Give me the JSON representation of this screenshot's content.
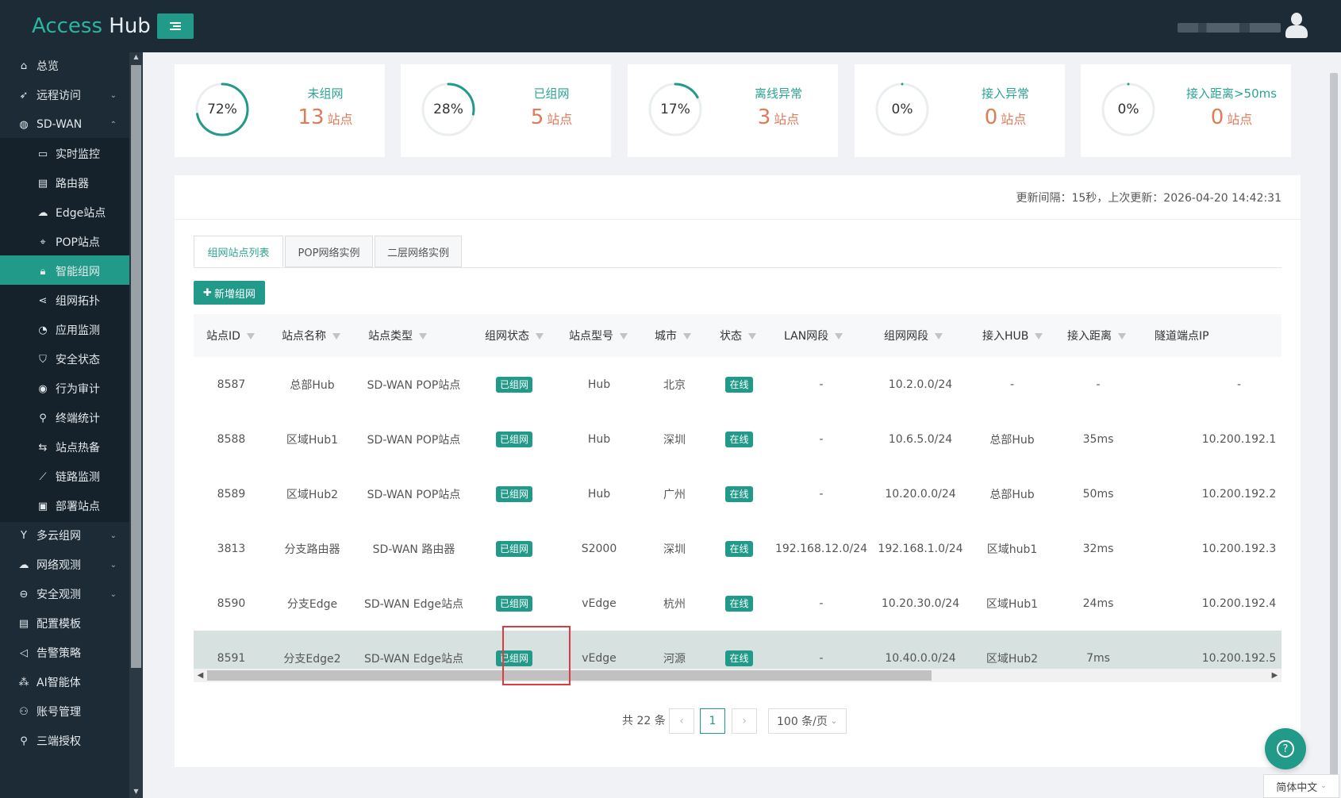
{
  "app": {
    "logo_access": "Access",
    "logo_hub": "Hub"
  },
  "colors": {
    "brand": "#229a89",
    "accent_text": "#2aa593",
    "stat_value": "#e07b5a",
    "header_bg": "#1d2b36"
  },
  "sidebar": {
    "items": [
      {
        "label": "总览",
        "icon": "home-icon",
        "glyph": "⌂"
      },
      {
        "label": "远程访问",
        "icon": "rocket-icon",
        "glyph": "➶",
        "chevron": "⌄"
      },
      {
        "label": "SD-WAN",
        "icon": "globe-icon",
        "glyph": "◍",
        "chevron": "⌃"
      },
      {
        "label": "实时监控",
        "icon": "monitor-icon",
        "glyph": "▭",
        "sub": true
      },
      {
        "label": "路由器",
        "icon": "router-icon",
        "glyph": "▤",
        "sub": true
      },
      {
        "label": "Edge站点",
        "icon": "cloud-icon",
        "glyph": "☁",
        "sub": true
      },
      {
        "label": "POP站点",
        "icon": "location-pin-icon",
        "glyph": "⌖",
        "sub": true
      },
      {
        "label": "智能组网",
        "icon": "lock-icon",
        "glyph": "🔒︎",
        "sub": true,
        "active": true
      },
      {
        "label": "组网拓扑",
        "icon": "share-icon",
        "glyph": "⋖",
        "sub": true
      },
      {
        "label": "应用监测",
        "icon": "pie-chart-icon",
        "glyph": "◔",
        "sub": true
      },
      {
        "label": "安全状态",
        "icon": "shield-check-icon",
        "glyph": "⛉",
        "sub": true
      },
      {
        "label": "行为审计",
        "icon": "eye-icon",
        "glyph": "◉",
        "sub": true
      },
      {
        "label": "终端统计",
        "icon": "search-icon",
        "glyph": "⚲",
        "sub": true
      },
      {
        "label": "站点热备",
        "icon": "swap-icon",
        "glyph": "⇆",
        "sub": true
      },
      {
        "label": "链路监测",
        "icon": "line-chart-icon",
        "glyph": "⟋",
        "sub": true
      },
      {
        "label": "部署站点",
        "icon": "deploy-icon",
        "glyph": "▣",
        "sub": true
      },
      {
        "label": "多云组网",
        "icon": "fork-icon",
        "glyph": "Y",
        "chevron": "⌄"
      },
      {
        "label": "网络观测",
        "icon": "cloud-icon",
        "glyph": "☁",
        "chevron": "⌄"
      },
      {
        "label": "安全观测",
        "icon": "minus-circle-icon",
        "glyph": "⊖",
        "chevron": "⌄"
      },
      {
        "label": "配置模板",
        "icon": "file-icon",
        "glyph": "▤"
      },
      {
        "label": "告警策略",
        "icon": "megaphone-icon",
        "glyph": "◁"
      },
      {
        "label": "AI智能体",
        "icon": "ai-node-icon",
        "glyph": "⁂"
      },
      {
        "label": "账号管理",
        "icon": "user-group-icon",
        "glyph": "⚇"
      },
      {
        "label": "三端授权",
        "icon": "search-icon",
        "glyph": "⚲"
      }
    ]
  },
  "stats": [
    {
      "percent_label": "72%",
      "percent": 0.72,
      "title": "未组网",
      "value": "13",
      "unit": "站点"
    },
    {
      "percent_label": "28%",
      "percent": 0.28,
      "title": "已组网",
      "value": "5",
      "unit": "站点"
    },
    {
      "percent_label": "17%",
      "percent": 0.17,
      "title": "离线异常",
      "value": "3",
      "unit": "站点"
    },
    {
      "percent_label": "0%",
      "percent": 0,
      "title": "接入异常",
      "value": "0",
      "unit": "站点"
    },
    {
      "percent_label": "0%",
      "percent": 0,
      "title": "接入距离>50ms",
      "value": "0",
      "unit": "站点"
    }
  ],
  "update_info": "更新间隔：15秒，上次更新：2026-04-20 14:42:31",
  "tabs": [
    "组网站点列表",
    "POP网络实例",
    "二层网络实例"
  ],
  "add_button": "新增组网",
  "table": {
    "columns": [
      "站点ID",
      "站点名称",
      "站点类型",
      "组网状态",
      "站点型号",
      "城市",
      "状态",
      "LAN网段",
      "组网网段",
      "接入HUB",
      "接入距离",
      "隧道端点IP"
    ],
    "rows": [
      [
        "8587",
        "总部Hub",
        "SD-WAN POP站点",
        "已组网",
        "Hub",
        "北京",
        "在线",
        "-",
        "10.2.0.0/24",
        "-",
        "-",
        "-"
      ],
      [
        "8588",
        "区域Hub1",
        "SD-WAN POP站点",
        "已组网",
        "Hub",
        "深圳",
        "在线",
        "-",
        "10.6.5.0/24",
        "总部Hub",
        "35ms",
        "10.200.192.1"
      ],
      [
        "8589",
        "区域Hub2",
        "SD-WAN POP站点",
        "已组网",
        "Hub",
        "广州",
        "在线",
        "-",
        "10.20.0.0/24",
        "总部Hub",
        "50ms",
        "10.200.192.2"
      ],
      [
        "3813",
        "分支路由器",
        "SD-WAN 路由器",
        "已组网",
        "S2000",
        "深圳",
        "在线",
        "192.168.12.0/24",
        "192.168.1.0/24",
        "区域hub1",
        "32ms",
        "10.200.192.3"
      ],
      [
        "8590",
        "分支Edge",
        "SD-WAN Edge站点",
        "已组网",
        "vEdge",
        "杭州",
        "在线",
        "-",
        "10.20.30.0/24",
        "区域Hub1",
        "24ms",
        "10.200.192.4"
      ],
      [
        "8591",
        "分支Edge2",
        "SD-WAN Edge站点",
        "已组网",
        "vEdge",
        "河源",
        "在线",
        "-",
        "10.40.0.0/24",
        "区域Hub2",
        "7ms",
        "10.200.192.5"
      ]
    ],
    "selected_row": 5
  },
  "pagination": {
    "total": "共 22 条",
    "prev": "‹",
    "current": "1",
    "next": "›",
    "page_size": "100 条/页"
  },
  "lang": "简体中文",
  "help_icon": "?"
}
